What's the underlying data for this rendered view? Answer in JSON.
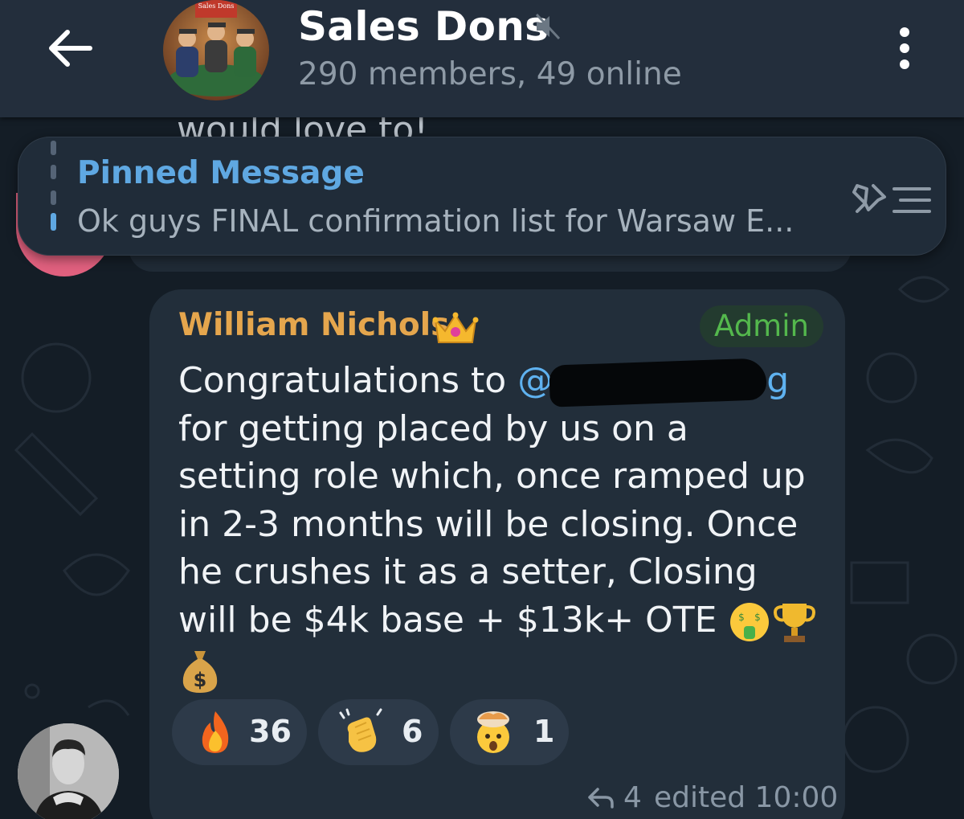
{
  "header": {
    "title": "Sales Dons",
    "subtitle": "290 members, 49 online",
    "avatar_sign": "Sales Dons"
  },
  "peek": {
    "text": "would love to!"
  },
  "pinned": {
    "label": "Pinned Message",
    "text": "Ok guys FINAL confirmation list for Warsaw E..."
  },
  "message": {
    "sender": "William Nichols",
    "badge": "Admin",
    "text_before_mention": "Congratulations to ",
    "mention_visible_start": "@",
    "mention_visible_end": "g",
    "text_after_mention": "for getting placed by us on a setting role which, once ramped up in 2-3 months will be closing. Once he crushes it as a setter, Closing will be $4k base + $13k+ OTE",
    "reactions": [
      {
        "emoji": "fire-emoji",
        "count": "36"
      },
      {
        "emoji": "clapping-hands-emoji",
        "count": "6"
      },
      {
        "emoji": "exploding-head-emoji",
        "count": "1"
      }
    ],
    "reply_count": "4",
    "time": "edited 10:00"
  },
  "colors": {
    "header_bg": "#232e3c",
    "bubble_bg": "#222e3a",
    "accent_blue": "#5fa8e2",
    "sender_orange": "#e5a64d",
    "admin_green": "#54b84d"
  }
}
